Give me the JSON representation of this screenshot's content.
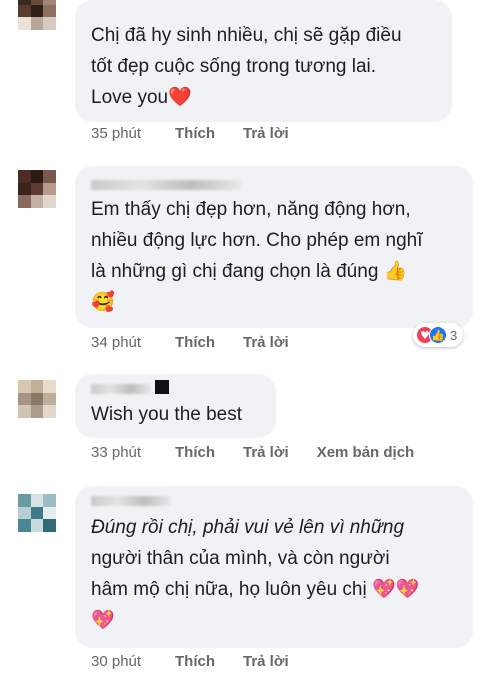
{
  "comments": [
    {
      "lines": [
        "Chị đã hy sinh nhiều, chị sẽ gặp điều",
        "tốt đẹp cuộc sống trong tương lai.",
        "Love you"
      ],
      "last_emoji": "❤️",
      "time": "35 phút",
      "like": "Thích",
      "reply": "Trả lời"
    },
    {
      "lines": [
        "Em thấy chị đẹp hơn, năng động hơn,",
        "nhiều động lực hơn. Cho phép em nghĩ",
        "là những gì chị đang chọn là đúng"
      ],
      "line3_emoji": "👍",
      "line4_emoji": "🥰",
      "time": "34 phút",
      "like": "Thích",
      "reply": "Trả lời",
      "reactions": {
        "count": "3"
      }
    },
    {
      "lines": [
        "Wish you the best"
      ],
      "time": "33 phút",
      "like": "Thích",
      "reply": "Trả lời",
      "translate": "Xem bản dịch"
    },
    {
      "lines": [
        "Đúng rồi chị, phải vui vẻ lên vì những",
        "người thân của mình, và còn người",
        "hâm mộ chị nữa, họ luôn yêu chị"
      ],
      "line3_emoji": "💖💖",
      "line4_emoji": "💖",
      "time": "30 phút",
      "like": "Thích",
      "reply": "Trả lời"
    }
  ]
}
